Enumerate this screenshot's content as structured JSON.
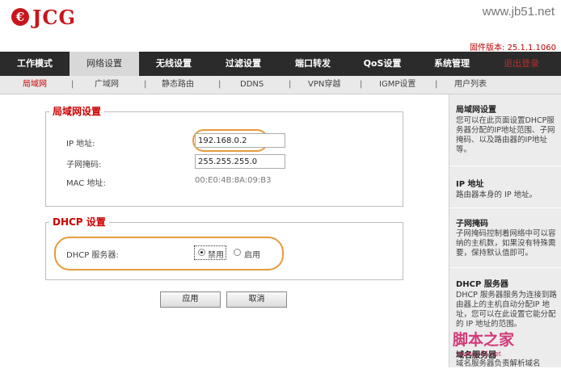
{
  "brand": {
    "mark": "€",
    "name": "JCG"
  },
  "watermark_top": "www.jb51.net",
  "firmware": "固件版本: 25.1.1.1060",
  "nav": {
    "items": [
      "工作模式",
      "网络设置",
      "无线设置",
      "过滤设置",
      "端口转发",
      "QoS设置",
      "系统管理",
      "退出登录"
    ],
    "active_index": 1
  },
  "subnav": {
    "items": [
      "局域网",
      "广域网",
      "静态路由",
      "DDNS",
      "VPN穿越",
      "IGMP设置",
      "用户列表"
    ],
    "separator": "|"
  },
  "lan": {
    "legend": "局域网设置",
    "ip_label": "IP 地址:",
    "ip_value": "192.168.0.2",
    "mask_label": "子网掩码:",
    "mask_value": "255.255.255.0",
    "mac_label": "MAC 地址:",
    "mac_value": "00:E0:4B:8A:09:B3"
  },
  "dhcp": {
    "legend": "DHCP 设置",
    "server_label": "DHCP 服务器:",
    "option_disable": "禁用",
    "option_enable": "启用",
    "selected": "禁用"
  },
  "buttons": {
    "apply": "应用",
    "cancel": "取消"
  },
  "help": {
    "lan_title": "局域网设置",
    "lan_text": "您可以在此页面设置DHCP服务器分配的IP地址范围、子网掩码、以及路由器的IP地址等。",
    "ip_title": "IP 地址",
    "ip_text": "路由器本身的 IP 地址。",
    "mask_title": "子网掩码",
    "mask_text": "子网掩码控制着网络中可以容纳的主机数，如果没有特殊需要，保持默认值即可。",
    "dhcp_title": "DHCP 服务器",
    "dhcp_text": "DHCP 服务器服务为连接到路由器上的主机自动分配IP 地址，您可以在此设置它能分配的 IP 地址的范围。",
    "domain_title": "域名服务器",
    "domain_text": "域名服务器负责解析域名"
  },
  "watermark_bottom": {
    "text": "脚本之家",
    "url": "www.jb51.net"
  }
}
